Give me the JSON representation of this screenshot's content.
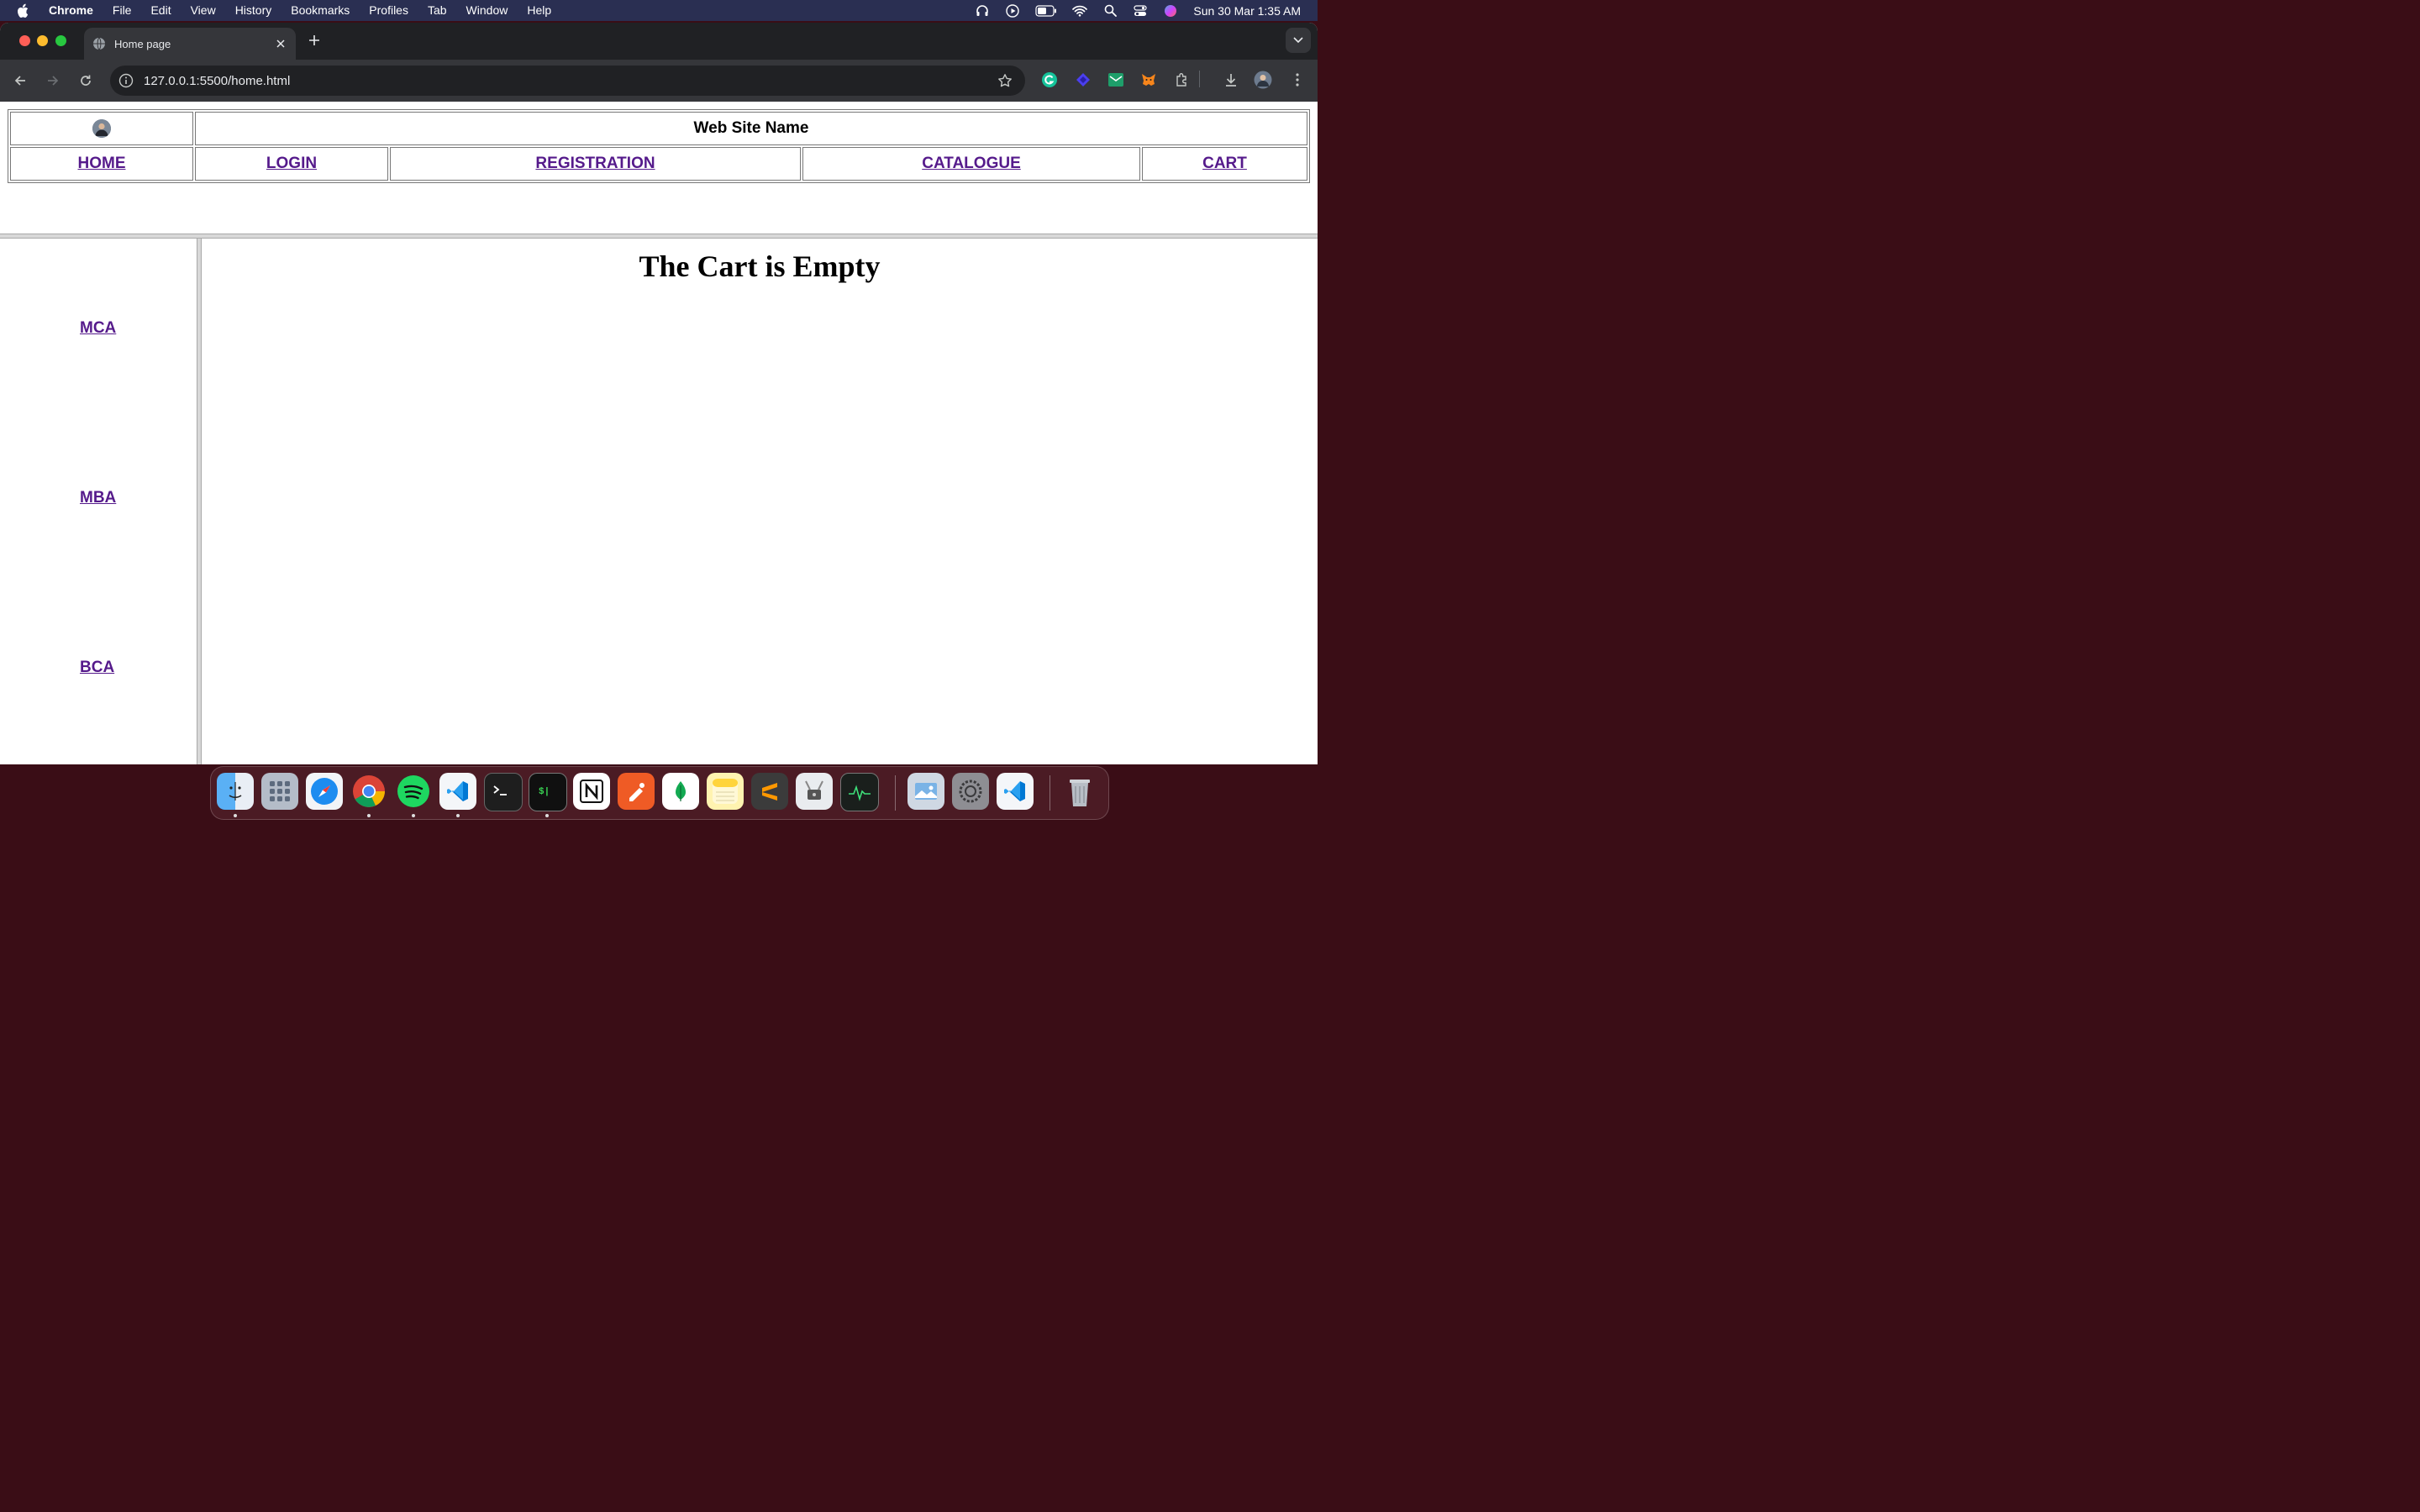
{
  "menubar": {
    "app_name": "Chrome",
    "items": [
      "File",
      "Edit",
      "View",
      "History",
      "Bookmarks",
      "Profiles",
      "Tab",
      "Window",
      "Help"
    ],
    "clock": "Sun 30 Mar  1:35 AM"
  },
  "browser": {
    "tab_title": "Home page",
    "url": "127.0.0.1:5500/home.html"
  },
  "page": {
    "site_name": "Web Site Name",
    "nav": {
      "home": "HOME",
      "login": "LOGIN",
      "registration": "REGISTRATION",
      "catalogue": "CATALOGUE",
      "cart": "CART"
    },
    "sidebar": {
      "mca": "MCA",
      "mba": "MBA",
      "bca": "BCA"
    },
    "cart_message": "The Cart is Empty"
  },
  "dock": {
    "apps": [
      "finder-icon",
      "launchpad-icon",
      "safari-icon",
      "chrome-icon",
      "spotify-icon",
      "vscode-icon",
      "terminal-icon",
      "iterm-icon",
      "notion-icon",
      "postman-icon",
      "mongodb-compass-icon",
      "notes-icon",
      "sublime-text-icon",
      "system-information-icon",
      "activity-monitor-icon",
      "preview-icon",
      "system-settings-icon",
      "vscode-icon",
      "trash-icon"
    ]
  },
  "colors": {
    "link": "#551a8b",
    "menubar": "#2a2f52",
    "chrome_dark": "#202124",
    "chrome_toolbar": "#35363a"
  }
}
